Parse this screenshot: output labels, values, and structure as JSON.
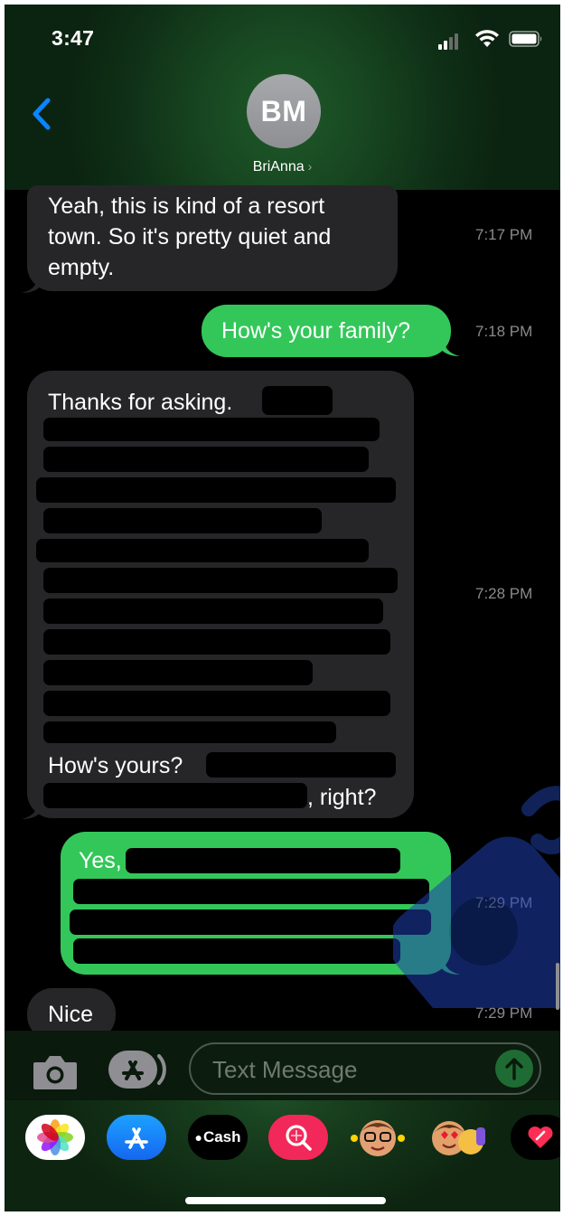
{
  "status": {
    "time": "3:47"
  },
  "header": {
    "avatar_initials": "BM",
    "contact_name": "BriAnna",
    "chevron": "›"
  },
  "messages": [
    {
      "dir": "in",
      "text": "Yeah, this is kind of a resort town. So it's pretty quiet and empty.",
      "time": "7:17 PM"
    },
    {
      "dir": "out",
      "text": "How's your family?",
      "time": "7:18 PM"
    },
    {
      "dir": "in",
      "text_start": "Thanks for asking.",
      "text_mid": "How's yours?",
      "text_end": ", right?",
      "time": "7:28 PM"
    },
    {
      "dir": "out",
      "text_start": "Yes,",
      "time": "7:29 PM"
    },
    {
      "dir": "in",
      "text": "Nice",
      "time": "7:29 PM"
    }
  ],
  "compose": {
    "placeholder": "Text Message"
  },
  "drawer": [
    {
      "icon": "photos-icon"
    },
    {
      "icon": "app-store-icon"
    },
    {
      "icon": "cash-icon",
      "label": "Cash"
    },
    {
      "icon": "search-images-icon"
    },
    {
      "icon": "memoji-icon"
    },
    {
      "icon": "animoji-stickers-icon"
    },
    {
      "icon": "digital-touch-icon"
    }
  ],
  "colors": {
    "outgoing": "#33c759",
    "incoming": "#262628",
    "accent": "#0a84ff"
  }
}
